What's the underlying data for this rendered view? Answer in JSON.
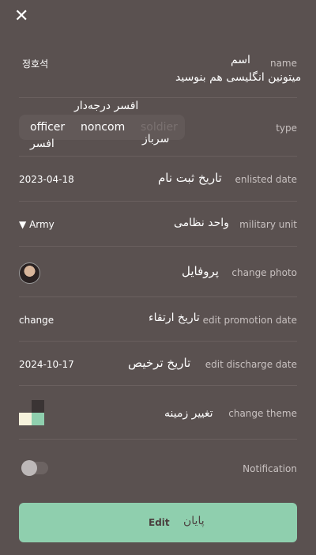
{
  "header": {
    "close_icon": "close-icon"
  },
  "name": {
    "label": "name",
    "value": "정호석",
    "fa_title": "اسم",
    "fa_hint": "میتونین انگلیسی هم بنوسید"
  },
  "type": {
    "label": "type",
    "options": [
      "officer",
      "noncom",
      "soldier"
    ],
    "fa_officer": "افسر",
    "fa_noncom": "افسر درجه‌دار",
    "fa_soldier": "سرباز"
  },
  "enlisted": {
    "label": "enlisted date",
    "value": "2023-04-18",
    "fa": "تاریخ ثبت نام"
  },
  "unit": {
    "label": "military unit",
    "value": "Army",
    "fa": "واحد نظامی"
  },
  "photo": {
    "label": "change photo",
    "fa": "پروفایل"
  },
  "promotion": {
    "label": "edit promotion date",
    "value": "change",
    "fa": "تاریخ ارتقاء"
  },
  "discharge": {
    "label": "edit discharge date",
    "value": "2024-10-17",
    "fa": "تاریخ ترخیص"
  },
  "theme": {
    "label": "change theme",
    "fa": "تغییر زمینه",
    "colors": [
      "#3a3434",
      "#f6f2dc",
      "#8fcfae",
      "#5a5150"
    ]
  },
  "notification": {
    "label": "Notification"
  },
  "edit": {
    "label": "Edit",
    "fa": "پایان"
  }
}
